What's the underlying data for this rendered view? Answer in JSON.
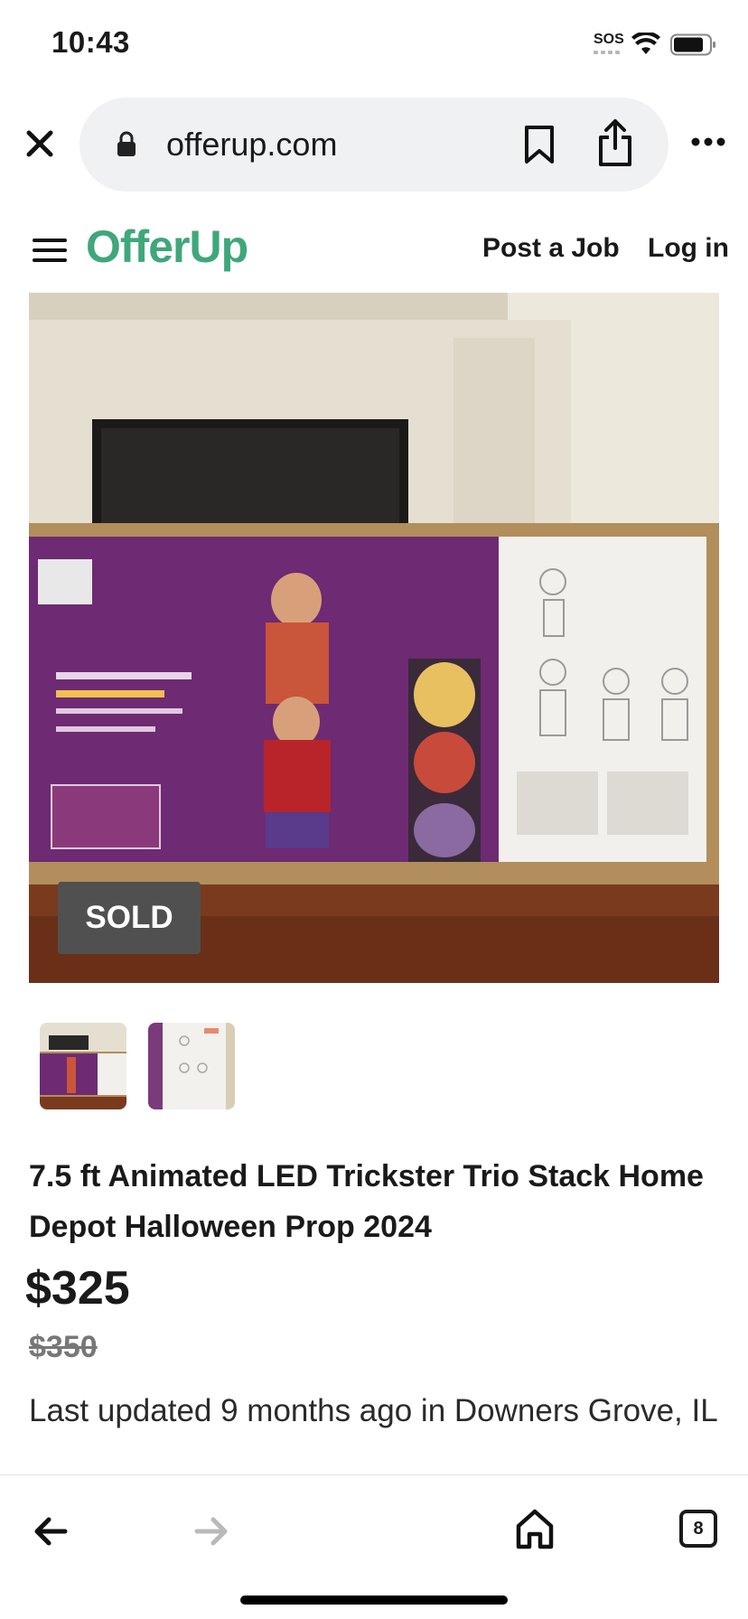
{
  "status_bar": {
    "time": "10:43",
    "sos": "SOS"
  },
  "browser": {
    "url": "offerup.com",
    "tab_count": "8"
  },
  "header": {
    "brand": "OfferUp",
    "post_job": "Post a Job",
    "login": "Log in"
  },
  "listing": {
    "badge": "SOLD",
    "title": "7.5 ft Animated LED Trickster Trio Stack Home Depot Halloween Prop 2024",
    "price": "$325",
    "original_price": "$350",
    "updated": "Last updated 9 months ago in Downers Grove, IL"
  },
  "colors": {
    "brand_green": "#3fa77b",
    "sold_badge": "#505050",
    "box_purple": "#6e2a72",
    "floor_wood": "#7a3a1e"
  },
  "icons": {
    "close": "close-icon",
    "lock": "lock-icon",
    "bookmark": "bookmark-icon",
    "share": "share-icon",
    "more": "more-icon",
    "menu": "hamburger-icon",
    "back": "back-icon",
    "forward": "forward-icon",
    "home": "home-icon",
    "tabs": "tabs-icon"
  }
}
